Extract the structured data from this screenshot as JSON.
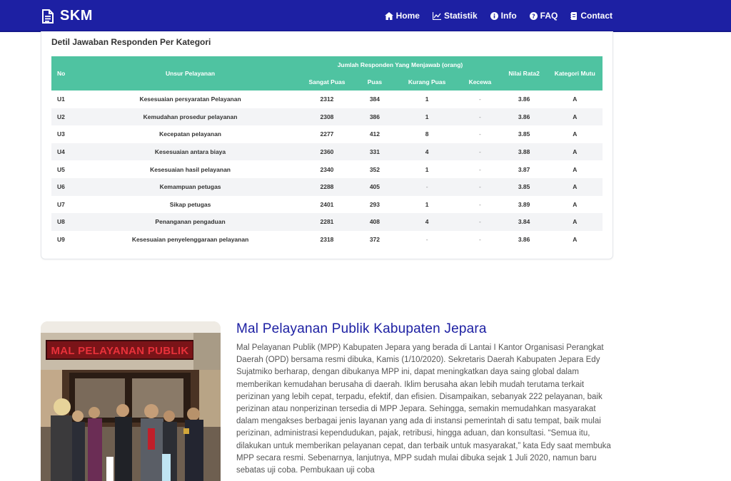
{
  "brand": {
    "name": "SKM",
    "icon": "document-icon"
  },
  "nav": {
    "items": [
      {
        "label": "Home",
        "icon": "home-icon"
      },
      {
        "label": "Statistik",
        "icon": "chart-icon"
      },
      {
        "label": "Info",
        "icon": "info-icon"
      },
      {
        "label": "FAQ",
        "icon": "question-icon"
      },
      {
        "label": "Contact",
        "icon": "contact-icon"
      }
    ]
  },
  "card": {
    "title": "Detil Jawaban Responden Per Kategori",
    "headers": {
      "no": "No",
      "unsur": "Unsur Pelayanan",
      "group": "Jumlah Responden Yang Menjawab (orang)",
      "sangat_puas": "Sangat Puas",
      "puas": "Puas",
      "kurang_puas": "Kurang Puas",
      "kecewa": "Kecewa",
      "nilai": "Nilai Rata2",
      "kategori": "Kategori Mutu"
    },
    "rows": [
      {
        "no": "U1",
        "unsur": "Kesesuaian persyaratan Pelayanan",
        "sp": "2312",
        "p": "384",
        "kp": "1",
        "k": "-",
        "nr": "3.86",
        "km": "A"
      },
      {
        "no": "U2",
        "unsur": "Kemudahan prosedur pelayanan",
        "sp": "2308",
        "p": "386",
        "kp": "1",
        "k": "-",
        "nr": "3.86",
        "km": "A"
      },
      {
        "no": "U3",
        "unsur": "Kecepatan pelayanan",
        "sp": "2277",
        "p": "412",
        "kp": "8",
        "k": "-",
        "nr": "3.85",
        "km": "A"
      },
      {
        "no": "U4",
        "unsur": "Kesesuaian antara biaya",
        "sp": "2360",
        "p": "331",
        "kp": "4",
        "k": "-",
        "nr": "3.88",
        "km": "A"
      },
      {
        "no": "U5",
        "unsur": "Kesesuaian hasil pelayanan",
        "sp": "2340",
        "p": "352",
        "kp": "1",
        "k": "-",
        "nr": "3.87",
        "km": "A"
      },
      {
        "no": "U6",
        "unsur": "Kemampuan petugas",
        "sp": "2288",
        "p": "405",
        "kp": "-",
        "k": "-",
        "nr": "3.85",
        "km": "A"
      },
      {
        "no": "U7",
        "unsur": "Sikap petugas",
        "sp": "2401",
        "p": "293",
        "kp": "1",
        "k": "-",
        "nr": "3.89",
        "km": "A"
      },
      {
        "no": "U8",
        "unsur": "Penanganan pengaduan",
        "sp": "2281",
        "p": "408",
        "kp": "4",
        "k": "-",
        "nr": "3.84",
        "km": "A"
      },
      {
        "no": "U9",
        "unsur": "Kesesuaian penyelenggaraan pelayanan",
        "sp": "2318",
        "p": "372",
        "kp": "-",
        "k": "-",
        "nr": "3.86",
        "km": "A"
      }
    ]
  },
  "article": {
    "photo_sign": "MAL PELAYANAN PUBLIK",
    "title": "Mal Pelayanan Publik Kabupaten Jepara",
    "body": "Mal Pelayanan Publik (MPP) Kabupaten Jepara yang berada di Lantai I Kantor Organisasi Perangkat Daerah (OPD) bersama resmi dibuka, Kamis (1/10/2020). Sekretaris Daerah Kabupaten Jepara Edy Sujatmiko berharap, dengan dibukanya MPP ini, dapat meningkatkan daya saing global dalam memberikan kemudahan berusaha di daerah. Iklim berusaha akan lebih mudah terutama terkait perizinan yang lebih cepat, terpadu, efektif, dan efisien. Disampaikan, sebanyak 222 pelayanan, baik perizinan atau nonperizinan tersedia di MPP Jepara. Sehingga, semakin memudahkan masyarakat dalam mengakses berbagai jenis layanan yang ada di instansi pemerintah di satu tempat, baik mulai perizinan, administrasi kependudukan, pajak, retribusi, hingga aduan, dan konsultasi. “Semua itu, dilakukan untuk memberikan pelayanan cepat, dan terbaik untuk masyarakat,” kata Edy saat membuka MPP secara resmi. Sebenarnya, lanjutnya, MPP sudah mulai dibuka sejak 1 Juli 2020, namun baru sebatas uji coba. Pembukaan uji coba"
  },
  "colors": {
    "navbar": "#1d20a3",
    "table_header": "#4fc3a1",
    "title": "#1d20a3"
  }
}
